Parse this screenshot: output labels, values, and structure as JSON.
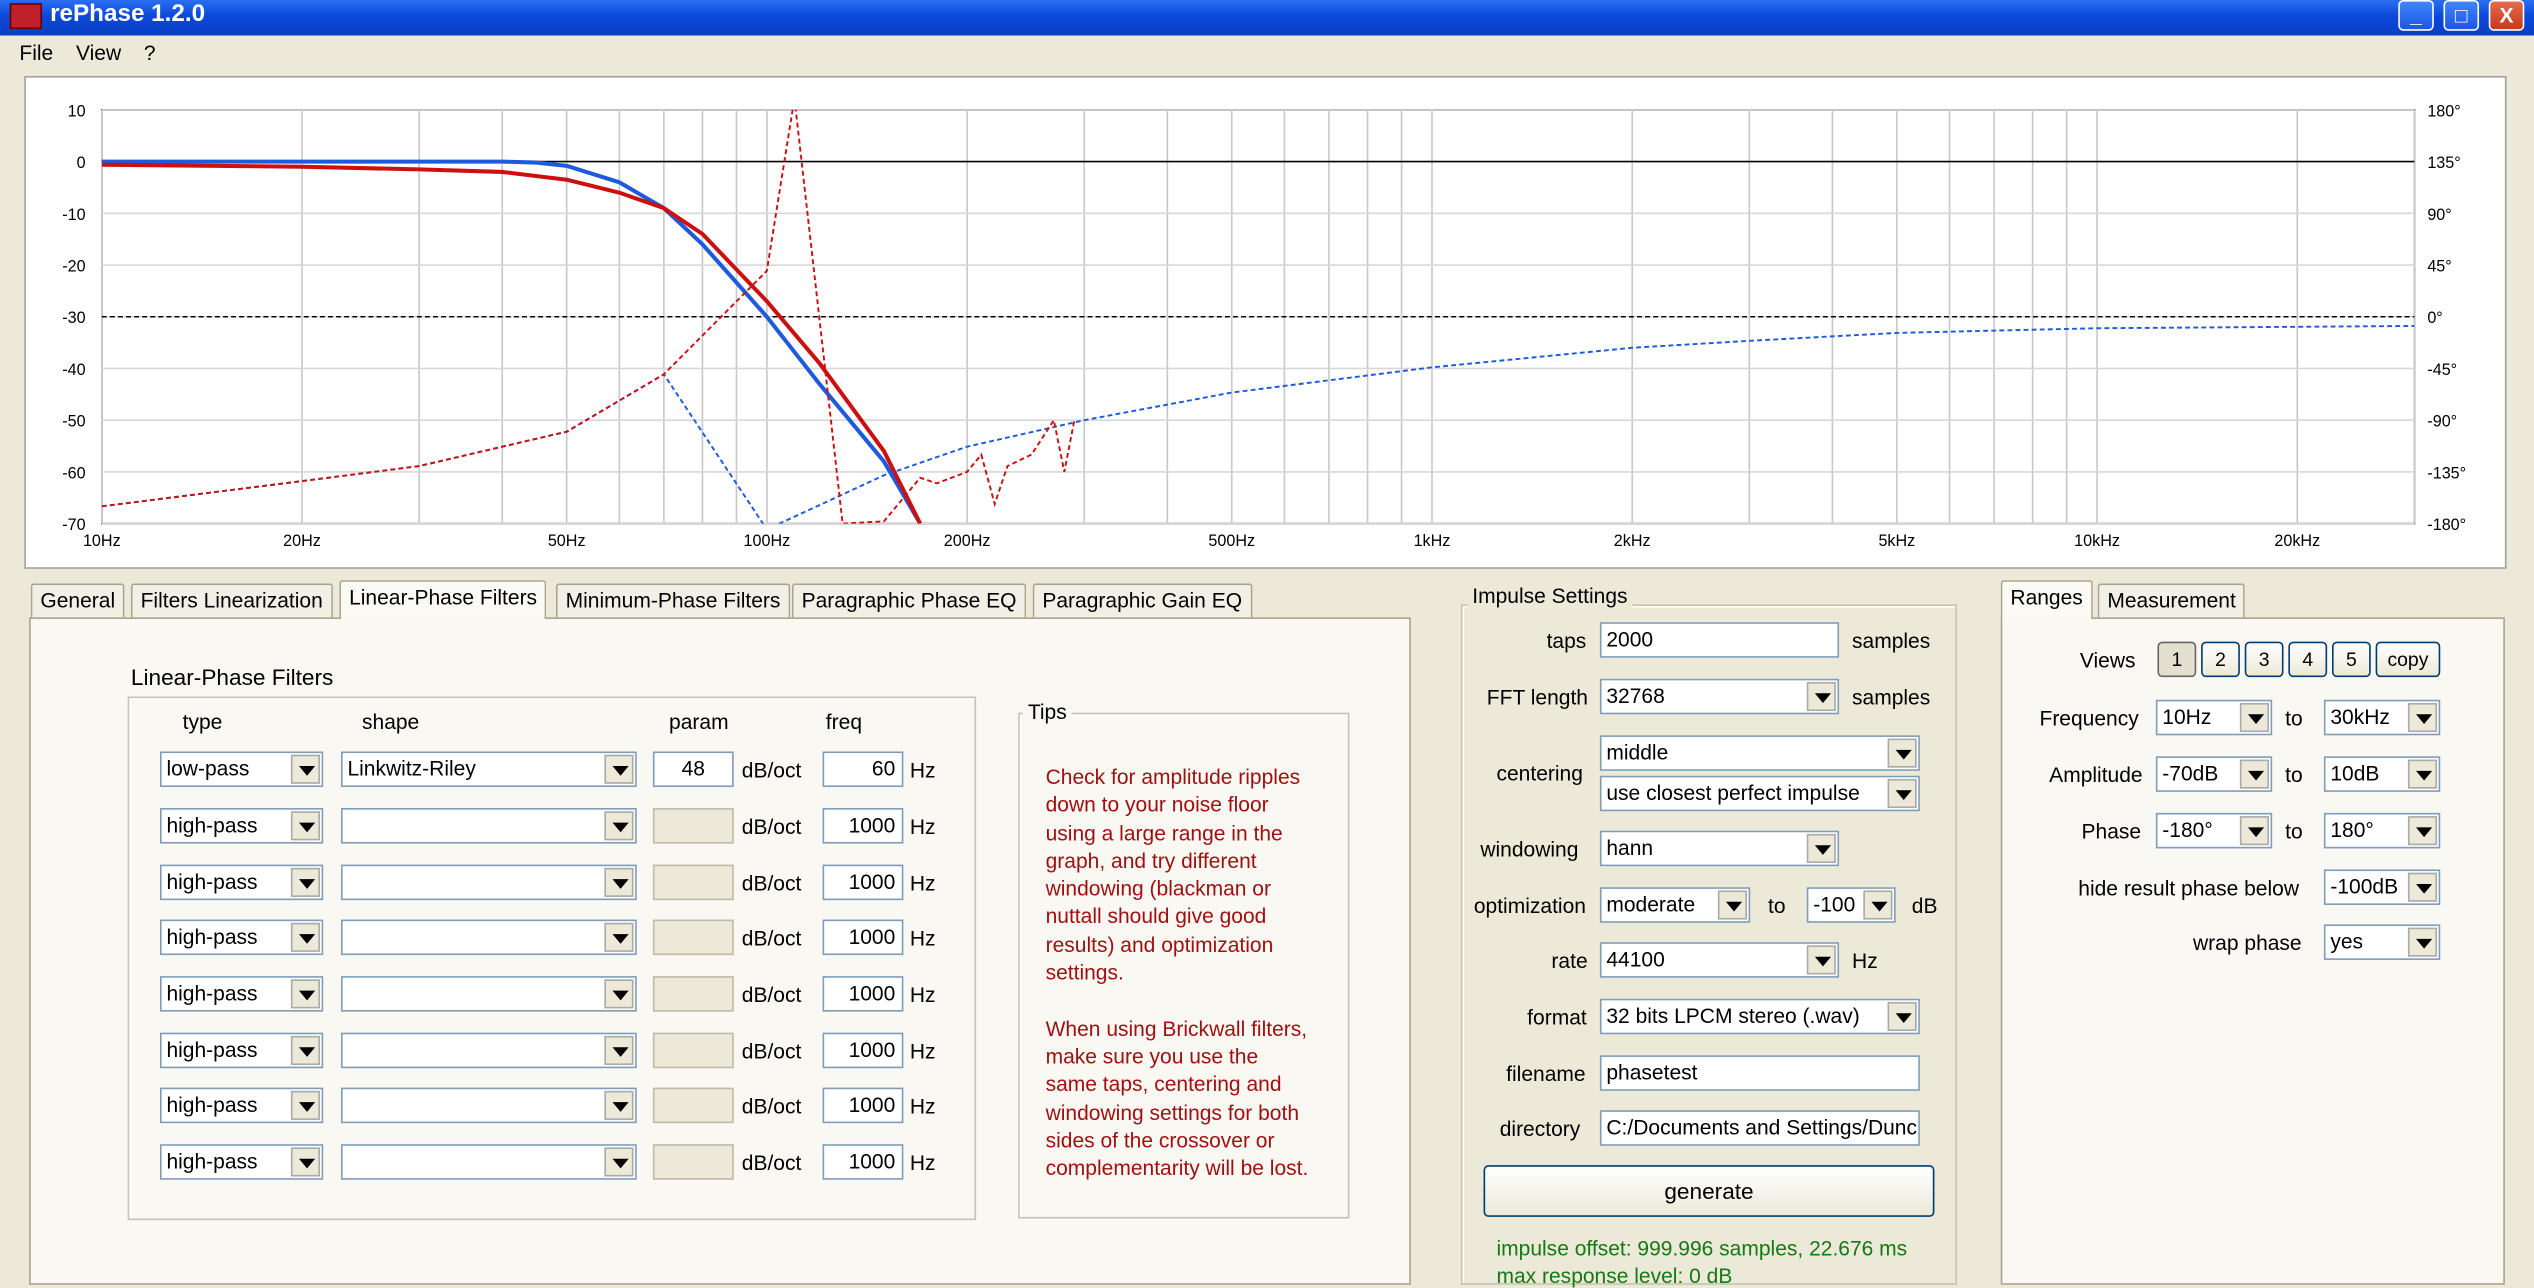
{
  "window": {
    "title": "rePhase 1.2.0",
    "buttons": [
      "_",
      "□",
      "X"
    ]
  },
  "menu": [
    "File",
    "View",
    "?"
  ],
  "chart_data": {
    "type": "line",
    "x_scale": "log",
    "xlim": [
      10,
      30000
    ],
    "ylim": [
      -70,
      10
    ],
    "y2lim": [
      -180,
      180
    ],
    "x_ticks": [
      {
        "v": 10,
        "l": "10Hz"
      },
      {
        "v": 20,
        "l": "20Hz"
      },
      {
        "v": 50,
        "l": "50Hz"
      },
      {
        "v": 100,
        "l": "100Hz"
      },
      {
        "v": 200,
        "l": "200Hz"
      },
      {
        "v": 500,
        "l": "500Hz"
      },
      {
        "v": 1000,
        "l": "1kHz"
      },
      {
        "v": 2000,
        "l": "2kHz"
      },
      {
        "v": 5000,
        "l": "5kHz"
      },
      {
        "v": 10000,
        "l": "10kHz"
      },
      {
        "v": 20000,
        "l": "20kHz"
      }
    ],
    "y_ticks": [
      "10",
      "0",
      "-10",
      "-20",
      "-30",
      "-40",
      "-50",
      "-60",
      "-70"
    ],
    "y2_ticks": [
      "180°",
      "135°",
      "90°",
      "45°",
      "0°",
      "-45°",
      "-90°",
      "-135°",
      "-180°"
    ],
    "series": [
      {
        "color": "#1e5adc",
        "style": "solid",
        "axis": "left",
        "x": [
          10,
          20,
          30,
          40,
          45,
          50,
          60,
          70,
          80,
          100,
          120,
          150,
          170
        ],
        "y": [
          0,
          0,
          0,
          0,
          -0.2,
          -0.8,
          -4,
          -9,
          -16,
          -30,
          -43,
          -58,
          -70
        ]
      },
      {
        "color": "#cc1010",
        "style": "solid",
        "axis": "left",
        "x": [
          10,
          20,
          30,
          40,
          50,
          60,
          70,
          80,
          100,
          120,
          150,
          170
        ],
        "y": [
          -0.6,
          -1,
          -1.5,
          -2,
          -3.5,
          -6,
          -9,
          -14,
          -27,
          -39,
          -56,
          -70
        ]
      },
      {
        "color": "#1e5adc",
        "style": "dashed",
        "axis": "right",
        "x": [
          10,
          20,
          30,
          50,
          70,
          100,
          150,
          200,
          300,
          500,
          1000,
          2000,
          3000,
          5000,
          10000,
          30000
        ],
        "y": [
          -165,
          -143,
          -130,
          -100,
          -50,
          -185,
          -138,
          -113,
          -90,
          -66,
          -44,
          -27,
          -21,
          -14,
          -10,
          -8
        ]
      },
      {
        "color": "#cc1010",
        "style": "dashed",
        "axis": "right",
        "x": [
          10,
          20,
          30,
          50,
          70,
          100,
          110,
          130,
          150,
          170,
          180,
          200,
          210,
          220,
          230,
          250,
          270,
          280,
          290
        ],
        "y": [
          -165,
          -143,
          -130,
          -100,
          -50,
          40,
          190,
          -180,
          -178,
          -140,
          -145,
          -135,
          -120,
          -163,
          -130,
          -120,
          -90,
          -135,
          -90
        ]
      }
    ]
  },
  "tabs": [
    "General",
    "Filters Linearization",
    "Linear-Phase Filters",
    "Minimum-Phase Filters",
    "Paragraphic Phase EQ",
    "Paragraphic Gain EQ"
  ],
  "linear": {
    "title": "Linear-Phase Filters",
    "headers": {
      "type": "type",
      "shape": "shape",
      "param": "param",
      "freq": "freq"
    },
    "unit_param": "dB/oct",
    "unit_freq": "Hz",
    "rows": [
      {
        "type": "low-pass",
        "shape": "Linkwitz-Riley",
        "param": "48",
        "freq": "60"
      },
      {
        "type": "high-pass",
        "shape": "",
        "param": "",
        "freq": "1000"
      },
      {
        "type": "high-pass",
        "shape": "",
        "param": "",
        "freq": "1000"
      },
      {
        "type": "high-pass",
        "shape": "",
        "param": "",
        "freq": "1000"
      },
      {
        "type": "high-pass",
        "shape": "",
        "param": "",
        "freq": "1000"
      },
      {
        "type": "high-pass",
        "shape": "",
        "param": "",
        "freq": "1000"
      },
      {
        "type": "high-pass",
        "shape": "",
        "param": "",
        "freq": "1000"
      },
      {
        "type": "high-pass",
        "shape": "",
        "param": "",
        "freq": "1000"
      }
    ]
  },
  "tips": {
    "title": "Tips",
    "text": "Check for amplitude ripples\ndown to your noise floor\nusing a large range in the\ngraph, and try different\nwindowing (blackman or\nnuttall should give good\nresults) and optimization\nsettings.\n\nWhen using Brickwall filters,\nmake sure you use the\nsame taps, centering and\nwindowing settings for both\nsides of the crossover or\ncomplementarity will be lost."
  },
  "impulse": {
    "title": "Impulse Settings",
    "taps_label": "taps",
    "taps": "2000",
    "samples": "samples",
    "fft_label": "FFT length",
    "fft": "32768",
    "centering_label": "centering",
    "centering": "middle",
    "centering2": "use closest perfect impulse",
    "windowing_label": "windowing",
    "windowing": "hann",
    "opt_label": "optimization",
    "opt": "moderate",
    "to": "to",
    "opt_db": "-100",
    "db": "dB",
    "rate_label": "rate",
    "rate": "44100",
    "hz": "Hz",
    "format_label": "format",
    "format": "32 bits LPCM stereo (.wav)",
    "filename_label": "filename",
    "filename": "phasetest",
    "directory_label": "directory",
    "directory": "C:/Documents and Settings/Dunc",
    "generate": "generate",
    "offset": "impulse offset: 999.996 samples, 22.676 ms",
    "maxlevel": "max response level: 0 dB"
  },
  "ranges": {
    "tabs": [
      "Ranges",
      "Measurement"
    ],
    "views_label": "Views",
    "views": [
      "1",
      "2",
      "3",
      "4",
      "5",
      "copy"
    ],
    "freq_label": "Frequency",
    "freq_from": "10Hz",
    "freq_to": "30kHz",
    "amp_label": "Amplitude",
    "amp_from": "-70dB",
    "amp_to": "10dB",
    "phase_label": "Phase",
    "phase_from": "-180°",
    "phase_to": "180°",
    "to": "to",
    "hide_label": "hide result phase below",
    "hide": "-100dB",
    "wrap_label": "wrap phase",
    "wrap": "yes"
  }
}
